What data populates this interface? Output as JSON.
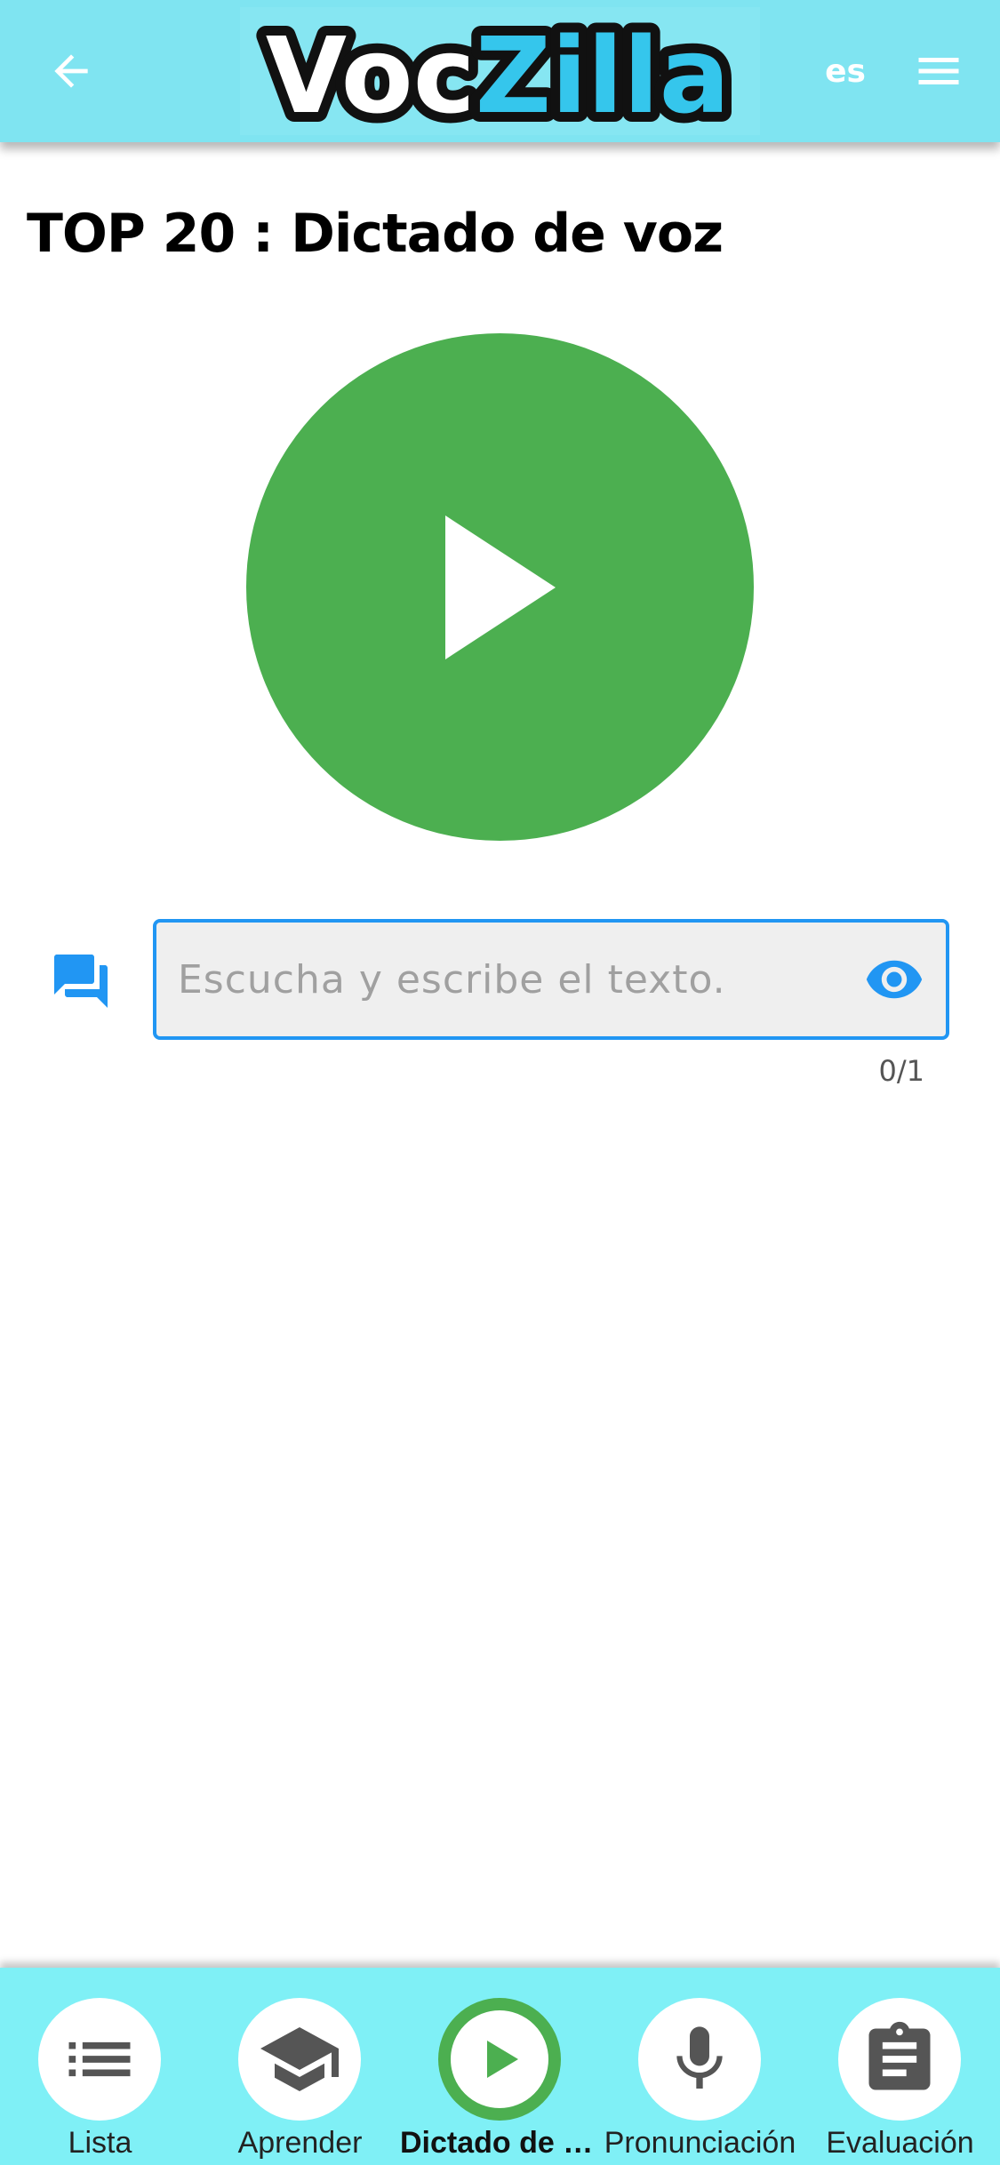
{
  "app": {
    "logo_part1": "Voc",
    "logo_part2": "Zilla",
    "language": "es",
    "brand_colors": {
      "bar": "#7fe4f1",
      "logo_accent": "#35c6ec",
      "play": "#4caf50",
      "focus": "#2196f3"
    }
  },
  "page": {
    "title": "TOP 20 : Dictado de voz"
  },
  "dictation": {
    "placeholder": "Escucha y escribe el texto.",
    "counter": "0/1"
  },
  "nav": {
    "items": [
      {
        "label": "Lista",
        "icon": "list-icon",
        "active": false
      },
      {
        "label": "Aprender",
        "icon": "graduation-cap-icon",
        "active": false
      },
      {
        "label": "Dictado de voz",
        "icon": "play-icon",
        "active": true
      },
      {
        "label": "Pronunciación",
        "icon": "microphone-icon",
        "active": false
      },
      {
        "label": "Evaluación",
        "icon": "clipboard-icon",
        "active": false
      }
    ]
  }
}
